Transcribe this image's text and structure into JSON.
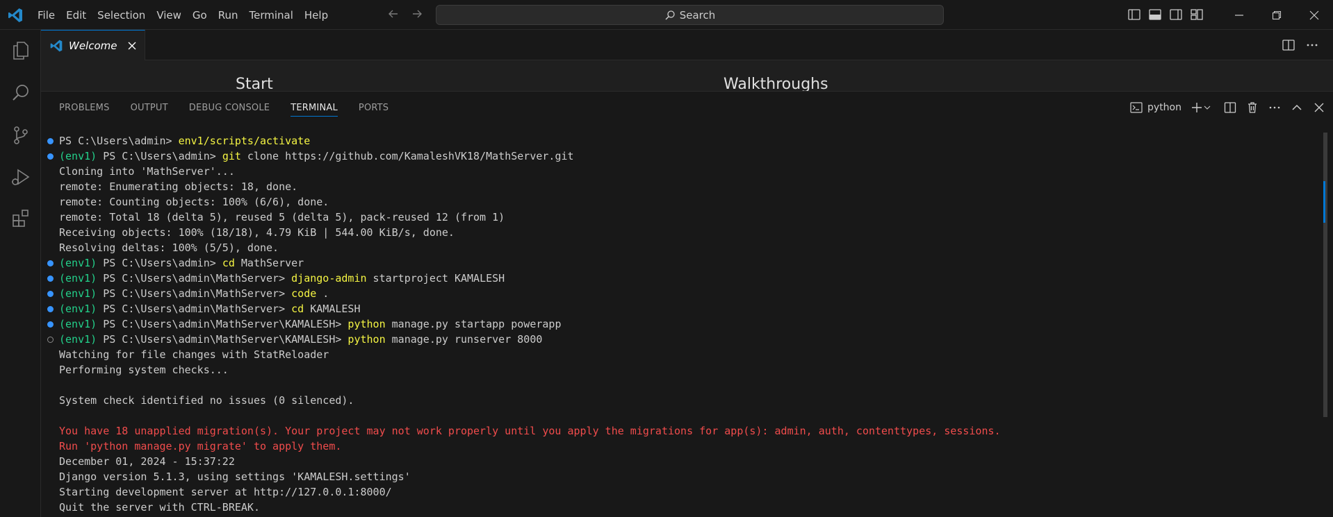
{
  "menu": [
    "File",
    "Edit",
    "Selection",
    "View",
    "Go",
    "Run",
    "Terminal",
    "Help"
  ],
  "search": {
    "label": "Search"
  },
  "editor_tab": {
    "label": "Welcome"
  },
  "welcome": {
    "start": "Start",
    "walkthroughs": "Walkthroughs"
  },
  "panel_tabs": [
    "PROBLEMS",
    "OUTPUT",
    "DEBUG CONSOLE",
    "TERMINAL",
    "PORTS"
  ],
  "panel_active_tab": "TERMINAL",
  "terminal_type": "python",
  "colors": {
    "accent": "#0078d4",
    "env_prompt": "#23d18b",
    "command": "#f5f543",
    "error": "#f14c4c"
  },
  "terminal_lines": [
    {
      "dot": "filled",
      "parts": [
        [
          "plain",
          "PS C:\\Users\\admin> "
        ],
        [
          "cmd",
          "env1/scripts/activate"
        ]
      ]
    },
    {
      "dot": "filled",
      "parts": [
        [
          "env",
          "(env1) "
        ],
        [
          "plain",
          "PS C:\\Users\\admin> "
        ],
        [
          "cmd",
          "git"
        ],
        [
          "plain",
          " clone https://github.com/KamaleshVK18/MathServer.git"
        ]
      ]
    },
    {
      "dot": "none",
      "parts": [
        [
          "plain",
          "Cloning into 'MathServer'..."
        ]
      ]
    },
    {
      "dot": "none",
      "parts": [
        [
          "plain",
          "remote: Enumerating objects: 18, done."
        ]
      ]
    },
    {
      "dot": "none",
      "parts": [
        [
          "plain",
          "remote: Counting objects: 100% (6/6), done."
        ]
      ]
    },
    {
      "dot": "none",
      "parts": [
        [
          "plain",
          "remote: Total 18 (delta 5), reused 5 (delta 5), pack-reused 12 (from 1)"
        ]
      ]
    },
    {
      "dot": "none",
      "parts": [
        [
          "plain",
          "Receiving objects: 100% (18/18), 4.79 KiB | 544.00 KiB/s, done."
        ]
      ]
    },
    {
      "dot": "none",
      "parts": [
        [
          "plain",
          "Resolving deltas: 100% (5/5), done."
        ]
      ]
    },
    {
      "dot": "filled",
      "parts": [
        [
          "env",
          "(env1) "
        ],
        [
          "plain",
          "PS C:\\Users\\admin> "
        ],
        [
          "cmd",
          "cd"
        ],
        [
          "plain",
          " MathServer"
        ]
      ]
    },
    {
      "dot": "filled",
      "parts": [
        [
          "env",
          "(env1) "
        ],
        [
          "plain",
          "PS C:\\Users\\admin\\MathServer> "
        ],
        [
          "cmd",
          "django-admin"
        ],
        [
          "plain",
          " startproject KAMALESH"
        ]
      ]
    },
    {
      "dot": "filled",
      "parts": [
        [
          "env",
          "(env1) "
        ],
        [
          "plain",
          "PS C:\\Users\\admin\\MathServer> "
        ],
        [
          "cmd",
          "code"
        ],
        [
          "plain",
          " ."
        ]
      ]
    },
    {
      "dot": "filled",
      "parts": [
        [
          "env",
          "(env1) "
        ],
        [
          "plain",
          "PS C:\\Users\\admin\\MathServer> "
        ],
        [
          "cmd",
          "cd"
        ],
        [
          "plain",
          " KAMALESH"
        ]
      ]
    },
    {
      "dot": "filled",
      "parts": [
        [
          "env",
          "(env1) "
        ],
        [
          "plain",
          "PS C:\\Users\\admin\\MathServer\\KAMALESH> "
        ],
        [
          "cmd",
          "python"
        ],
        [
          "plain",
          " manage.py startapp powerapp"
        ]
      ]
    },
    {
      "dot": "hollow",
      "parts": [
        [
          "env",
          "(env1) "
        ],
        [
          "plain",
          "PS C:\\Users\\admin\\MathServer\\KAMALESH> "
        ],
        [
          "cmd",
          "python"
        ],
        [
          "plain",
          " manage.py runserver 8000"
        ]
      ]
    },
    {
      "dot": "none",
      "parts": [
        [
          "plain",
          "Watching for file changes with StatReloader"
        ]
      ]
    },
    {
      "dot": "none",
      "parts": [
        [
          "plain",
          "Performing system checks..."
        ]
      ]
    },
    {
      "dot": "none",
      "parts": [
        [
          "plain",
          ""
        ]
      ]
    },
    {
      "dot": "none",
      "parts": [
        [
          "plain",
          "System check identified no issues (0 silenced)."
        ]
      ]
    },
    {
      "dot": "none",
      "parts": [
        [
          "plain",
          ""
        ]
      ]
    },
    {
      "dot": "none",
      "parts": [
        [
          "err",
          "You have 18 unapplied migration(s). Your project may not work properly until you apply the migrations for app(s): admin, auth, contenttypes, sessions."
        ]
      ]
    },
    {
      "dot": "none",
      "parts": [
        [
          "err",
          "Run 'python manage.py migrate' to apply them."
        ]
      ]
    },
    {
      "dot": "none",
      "parts": [
        [
          "plain",
          "December 01, 2024 - 15:37:22"
        ]
      ]
    },
    {
      "dot": "none",
      "parts": [
        [
          "plain",
          "Django version 5.1.3, using settings 'KAMALESH.settings'"
        ]
      ]
    },
    {
      "dot": "none",
      "parts": [
        [
          "plain",
          "Starting development server at http://127.0.0.1:8000/"
        ]
      ]
    },
    {
      "dot": "none",
      "parts": [
        [
          "plain",
          "Quit the server with CTRL-BREAK."
        ]
      ]
    }
  ]
}
